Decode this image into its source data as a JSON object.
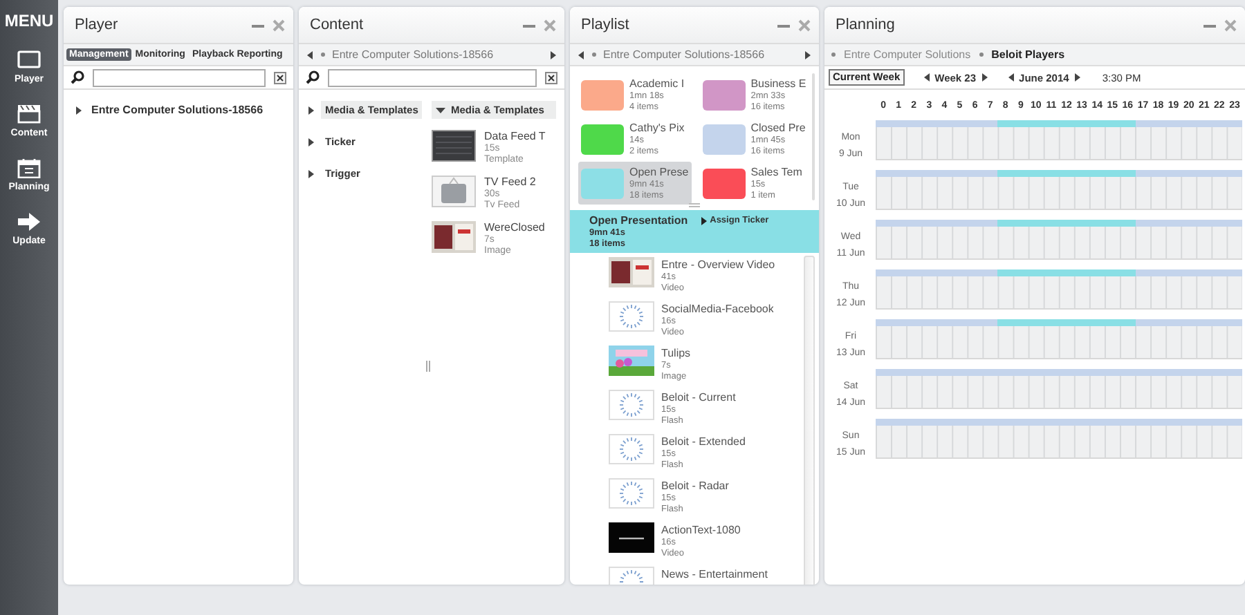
{
  "menu": {
    "title": "MENU",
    "items": [
      {
        "label": "Player",
        "kind": "monitor"
      },
      {
        "label": "Content",
        "kind": "film"
      },
      {
        "label": "Planning",
        "kind": "calendar"
      },
      {
        "label": "Update",
        "kind": "arrow"
      }
    ]
  },
  "player": {
    "title": "Player",
    "tabs": [
      {
        "label": "Management",
        "selected": true
      },
      {
        "label": "Monitoring",
        "selected": false
      },
      {
        "label": "Playback Reporting",
        "selected": false
      }
    ],
    "tree": [
      {
        "label": "Entre Computer Solutions-18566",
        "expanded": false
      }
    ]
  },
  "content": {
    "title": "Content",
    "breadcrumb": "Entre Computer Solutions-18566",
    "categories": [
      {
        "label": "Media & Templates",
        "selected": true
      },
      {
        "label": "Ticker",
        "selected": false
      },
      {
        "label": "Trigger",
        "selected": false
      }
    ],
    "media_header": "Media & Templates",
    "media": [
      {
        "name": "Data Feed T",
        "duration": "15s",
        "type": "Template",
        "kind": "screen"
      },
      {
        "name": "TV Feed 2",
        "duration": "30s",
        "type": "Tv Feed",
        "kind": "device"
      },
      {
        "name": "WereClosed",
        "duration": "7s",
        "type": "Image",
        "kind": "photo"
      }
    ]
  },
  "playlist": {
    "title": "Playlist",
    "breadcrumb": "Entre Computer Solutions-18566",
    "playlists": [
      {
        "name": "Academic I",
        "duration": "1mn 18s",
        "items": "4 items",
        "color": "#fba98a",
        "selected": false
      },
      {
        "name": "Business E",
        "duration": "2mn 33s",
        "items": "16 items",
        "color": "#d196c6",
        "selected": false
      },
      {
        "name": "Cathy's Pix",
        "duration": "14s",
        "items": "2 items",
        "color": "#4fd94a",
        "selected": false
      },
      {
        "name": "Closed Pre",
        "duration": "1mn 45s",
        "items": "16 items",
        "color": "#c4d4ec",
        "selected": false
      },
      {
        "name": "Open Prese",
        "duration": "9mn 41s",
        "items": "18 items",
        "color": "#8ddfe6",
        "selected": true
      },
      {
        "name": "Sales Tem",
        "duration": "15s",
        "items": "1 item",
        "color": "#fa4d57",
        "selected": false
      }
    ],
    "current": {
      "name": "Open Presentation",
      "duration": "9mn 41s",
      "items": "18 items",
      "action": "Assign Ticker"
    },
    "entries": [
      {
        "name": "Entre - Overview Video",
        "duration": "41s",
        "type": "Video",
        "kind": "photo"
      },
      {
        "name": "SocialMedia-Facebook",
        "duration": "16s",
        "type": "Video",
        "kind": "loading"
      },
      {
        "name": "Tulips",
        "duration": "7s",
        "type": "Image",
        "kind": "landscape"
      },
      {
        "name": "Beloit - Current",
        "duration": "15s",
        "type": "Flash",
        "kind": "loading"
      },
      {
        "name": "Beloit - Extended",
        "duration": "15s",
        "type": "Flash",
        "kind": "loading"
      },
      {
        "name": "Beloit - Radar",
        "duration": "15s",
        "type": "Flash",
        "kind": "loading"
      },
      {
        "name": "ActionText-1080",
        "duration": "16s",
        "type": "Video",
        "kind": "black"
      },
      {
        "name": "News - Entertainment",
        "kind": "loading"
      }
    ]
  },
  "planning": {
    "title": "Planning",
    "breadcrumbs": [
      {
        "label": "Entre Computer Solutions",
        "selected": false
      },
      {
        "label": "Beloit Players",
        "selected": true
      }
    ],
    "current_week": "Current Week",
    "week": "Week 23",
    "month": "June 2014",
    "time": "3:30 PM",
    "hours": [
      "0",
      "1",
      "2",
      "3",
      "4",
      "5",
      "6",
      "7",
      "8",
      "9",
      "10",
      "11",
      "12",
      "13",
      "14",
      "15",
      "16",
      "17",
      "18",
      "19",
      "20",
      "21",
      "22",
      "23"
    ],
    "days": [
      {
        "day": "Mon",
        "date": "9 Jun",
        "scheduled": true
      },
      {
        "day": "Tue",
        "date": "10 Jun",
        "scheduled": true
      },
      {
        "day": "Wed",
        "date": "11 Jun",
        "scheduled": true
      },
      {
        "day": "Thu",
        "date": "12 Jun",
        "scheduled": true
      },
      {
        "day": "Fri",
        "date": "13 Jun",
        "scheduled": true
      },
      {
        "day": "Sat",
        "date": "14 Jun",
        "scheduled": false
      },
      {
        "day": "Sun",
        "date": "15 Jun",
        "scheduled": false
      }
    ]
  }
}
